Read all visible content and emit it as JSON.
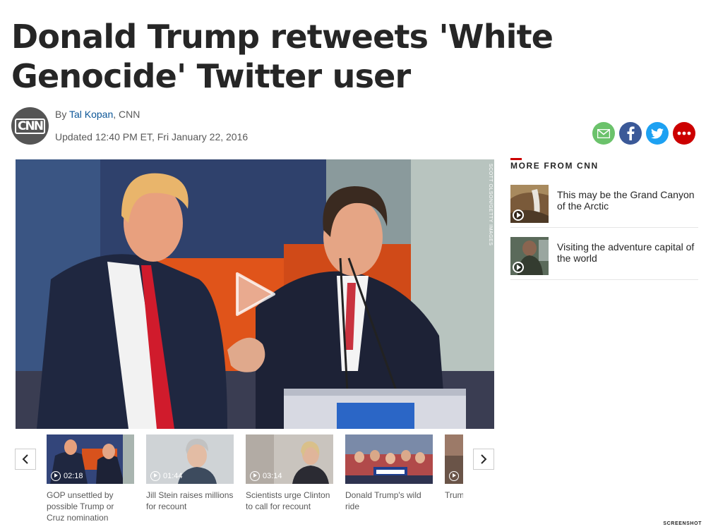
{
  "article": {
    "headline": "Donald Trump retweets 'White Genocide' Twitter user",
    "byline_prefix": "By ",
    "author": "Tal Kopan",
    "byline_suffix": ", CNN",
    "updated": "Updated 12:40 PM ET, Fri January 22, 2016",
    "logo_text": "CNN"
  },
  "share": {
    "icons": [
      "email-icon",
      "facebook-icon",
      "twitter-icon",
      "more-icon"
    ]
  },
  "video": {
    "photo_credit": "SCOTT OLSON/GETTY IMAGES"
  },
  "rail": {
    "title": "MORE FROM CNN",
    "items": [
      {
        "label": "This may be the Grand Canyon of the Arctic"
      },
      {
        "label": "Visiting the adventure capital of the world"
      }
    ]
  },
  "carousel": {
    "items": [
      {
        "duration": "02:18",
        "caption": "GOP unsettled by possible Trump or Cruz nomination"
      },
      {
        "duration": "01:44",
        "caption": "Jill Stein raises millions for recount"
      },
      {
        "duration": "03:14",
        "caption": "Scientists urge Clinton to call for recount"
      },
      {
        "duration": "",
        "caption": "Donald Trump's wild ride"
      },
      {
        "duration": "",
        "caption": "Trump the M"
      }
    ]
  },
  "watermark": "SCREENSHOT",
  "colors": {
    "cnn_red": "#cc0000",
    "link_blue": "#0c5697",
    "email_green": "#6bc26b",
    "facebook_blue": "#3b5998",
    "twitter_blue": "#1da1f2"
  }
}
